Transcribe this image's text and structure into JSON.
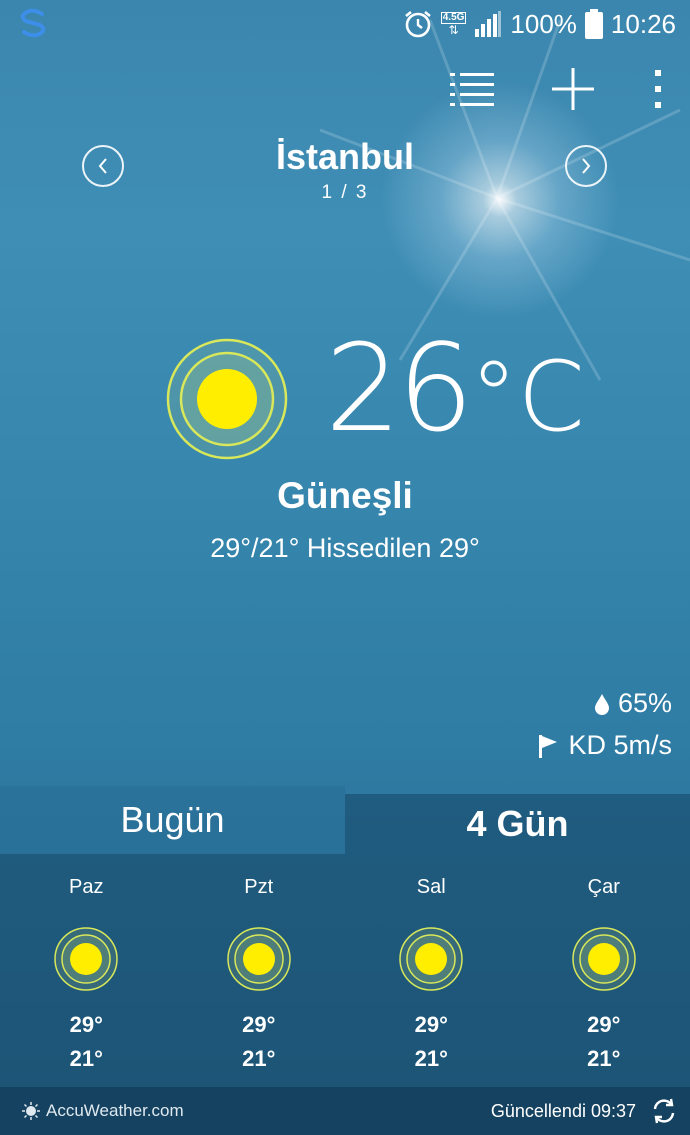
{
  "status_bar": {
    "network": "4.5G",
    "battery_pct": "100%",
    "time": "10:26",
    "icons": [
      "app-s-icon",
      "alarm-icon",
      "data-arrows-icon",
      "signal-icon",
      "battery-icon"
    ]
  },
  "toolbar": {
    "icons": [
      "list-icon",
      "add-icon",
      "more-vertical-icon"
    ]
  },
  "location": {
    "city": "İstanbul",
    "pager": "1 / 3"
  },
  "current": {
    "temp": "26",
    "unit": "°C",
    "condition": "Güneşli",
    "hilo_feels": "29°/21° Hissedilen 29°",
    "humidity": "65%",
    "wind": "KD 5m/s",
    "icon": "sun-icon"
  },
  "tabs": {
    "today": "Bugün",
    "four_day": "4 Gün",
    "selected": "four_day"
  },
  "forecast": [
    {
      "day": "Paz",
      "hi": "29°",
      "lo": "21°",
      "icon": "sun-icon"
    },
    {
      "day": "Pzt",
      "hi": "29°",
      "lo": "21°",
      "icon": "sun-icon"
    },
    {
      "day": "Sal",
      "hi": "29°",
      "lo": "21°",
      "icon": "sun-icon"
    },
    {
      "day": "Çar",
      "hi": "29°",
      "lo": "21°",
      "icon": "sun-icon"
    }
  ],
  "footer": {
    "brand": "AccuWeather.com",
    "updated": "Güncellendi 09:37"
  },
  "colors": {
    "sun_core": "#ffee00",
    "sun_ring": "#d8e85a",
    "accent_logo": "#3c8ee8"
  }
}
